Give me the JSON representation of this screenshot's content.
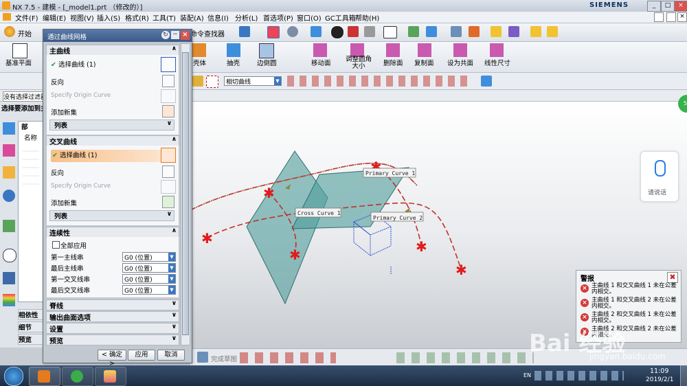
{
  "window": {
    "title": "NX 7.5 - 建模 - [_model1.prt （修改的）]",
    "brand": "SIEMENS",
    "controls": [
      "_",
      "□",
      "×"
    ]
  },
  "menubar": {
    "items": [
      "文件(F)",
      "编辑(E)",
      "视图(V)",
      "插入(S)",
      "格式(R)",
      "工具(T)",
      "装配(A)",
      "信息(I)",
      "分析(L)",
      "首选项(P)",
      "窗口(O)",
      "GC工具箱",
      "帮助(H)"
    ]
  },
  "toolbar1": {
    "start_label": "开始",
    "command_finder_label": "命令查找器"
  },
  "toolbar2": {
    "datum_plane_label": "基准平面",
    "shell_label": "壳体",
    "extract_label": "抽壳",
    "edge_blend_label": "边倒圆",
    "move_face_label": "移动面",
    "resize_blend_label": "调整圆角大小",
    "delete_face_label": "删除面",
    "copy_face_label": "复制面",
    "coplanar_label": "设为共面",
    "linear_dim_label": "线性尺寸"
  },
  "toolbar3": {
    "filter_value": "相切曲线"
  },
  "statusline": {
    "left_text": "没有选择过滤器",
    "prompt_text": "选择要添加到主"
  },
  "navigator": {
    "header": "部",
    "column_name": "名称",
    "bottom_tabs": [
      "相依性",
      "细节",
      "预览"
    ]
  },
  "dialog": {
    "title": "通过曲线网格",
    "primary": {
      "header": "主曲线",
      "select_label": "选择曲线 (1)",
      "reverse_label": "反向",
      "origin_label": "Specify Origin Curve",
      "add_new_label": "添加新集",
      "list_label": "列表"
    },
    "cross": {
      "header": "交叉曲线",
      "select_label": "选择曲线 (1)",
      "reverse_label": "反向",
      "origin_label": "Specify Origin Curve",
      "add_new_label": "添加新集",
      "list_label": "列表"
    },
    "continuity": {
      "header": "连续性",
      "apply_all_label": "全部应用",
      "rows": [
        {
          "label": "第一主线串",
          "value": "G0 (位置)"
        },
        {
          "label": "最后主线串",
          "value": "G0 (位置)"
        },
        {
          "label": "第一交叉线串",
          "value": "G0 (位置)"
        },
        {
          "label": "最后交叉线串",
          "value": "G0 (位置)"
        }
      ]
    },
    "collapsed_sections": [
      "脊线",
      "输出曲面选项",
      "设置",
      "预览"
    ],
    "buttons": {
      "ok": "< 确定 >",
      "apply": "应用",
      "cancel": "取消"
    }
  },
  "viewport": {
    "labels": {
      "primary1": "Primary Curve  1",
      "cross1": "Cross Curve  1",
      "primary2": "Primary Curve  2"
    },
    "voice_label": "请说话"
  },
  "alert": {
    "title": "警报",
    "items": [
      "主曲线 1 和交叉曲线 1 未在公差内相交。",
      "主曲线 1 和交叉曲线 2 未在公差内相交。",
      "主曲线 2 和交叉曲线 1 未在公差内相交。",
      "主曲线 2 和交叉曲线 2 未在公差内相交。"
    ]
  },
  "bottom_toolbar": {
    "finish_sketch_label": "完成草图"
  },
  "taskbar": {
    "time": "11:09",
    "date": "2019/2/1",
    "lang": "EN"
  },
  "watermark": {
    "text": "Bai 经验",
    "url": "jingyan.baidu.com"
  }
}
